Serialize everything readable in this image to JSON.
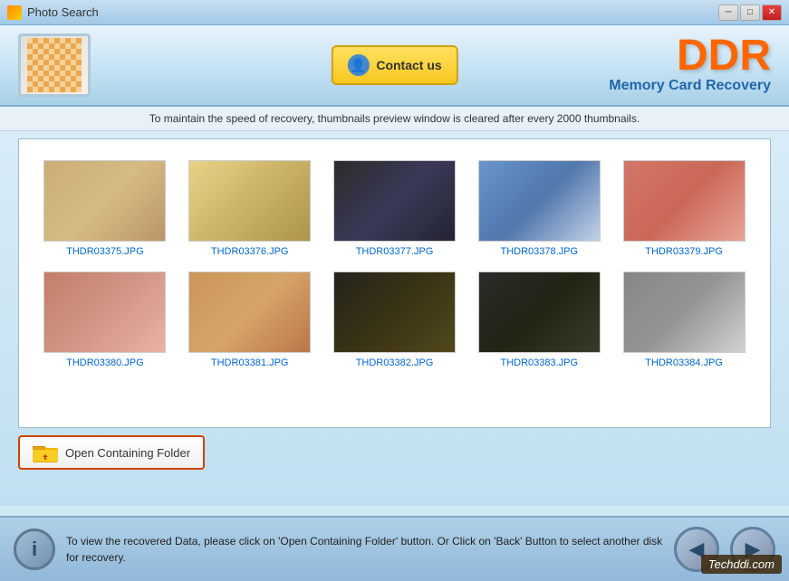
{
  "titlebar": {
    "title": "Photo Search",
    "icon": "photo-search-icon",
    "min_label": "─",
    "max_label": "□",
    "close_label": "✕"
  },
  "header": {
    "contact_btn_label": "Contact us",
    "ddr_title": "DDR",
    "ddr_subtitle": "Memory Card Recovery"
  },
  "info_bar": {
    "message": "To maintain the speed of recovery, thumbnails preview window is cleared after every 2000 thumbnails."
  },
  "thumbnails": [
    {
      "id": 1,
      "label": "THDR03375.JPG",
      "img_class": "img-1"
    },
    {
      "id": 2,
      "label": "THDR03376.JPG",
      "img_class": "img-2"
    },
    {
      "id": 3,
      "label": "THDR03377.JPG",
      "img_class": "img-3"
    },
    {
      "id": 4,
      "label": "THDR03378.JPG",
      "img_class": "img-4"
    },
    {
      "id": 5,
      "label": "THDR03379.JPG",
      "img_class": "img-5"
    },
    {
      "id": 6,
      "label": "THDR03380.JPG",
      "img_class": "img-6"
    },
    {
      "id": 7,
      "label": "THDR03381.JPG",
      "img_class": "img-7"
    },
    {
      "id": 8,
      "label": "THDR03382.JPG",
      "img_class": "img-8"
    },
    {
      "id": 9,
      "label": "THDR03383.JPG",
      "img_class": "img-9"
    },
    {
      "id": 10,
      "label": "THDR03384.JPG",
      "img_class": "img-10"
    }
  ],
  "open_folder_btn": {
    "label": "Open Containing Folder"
  },
  "bottom": {
    "info_text": "To view the recovered Data, please click on 'Open Containing Folder' button. Or Click on 'Back' Button to select another disk for recovery.",
    "back_icon": "◀",
    "forward_icon": "▶"
  },
  "watermark": {
    "text": "Techddi.com"
  }
}
